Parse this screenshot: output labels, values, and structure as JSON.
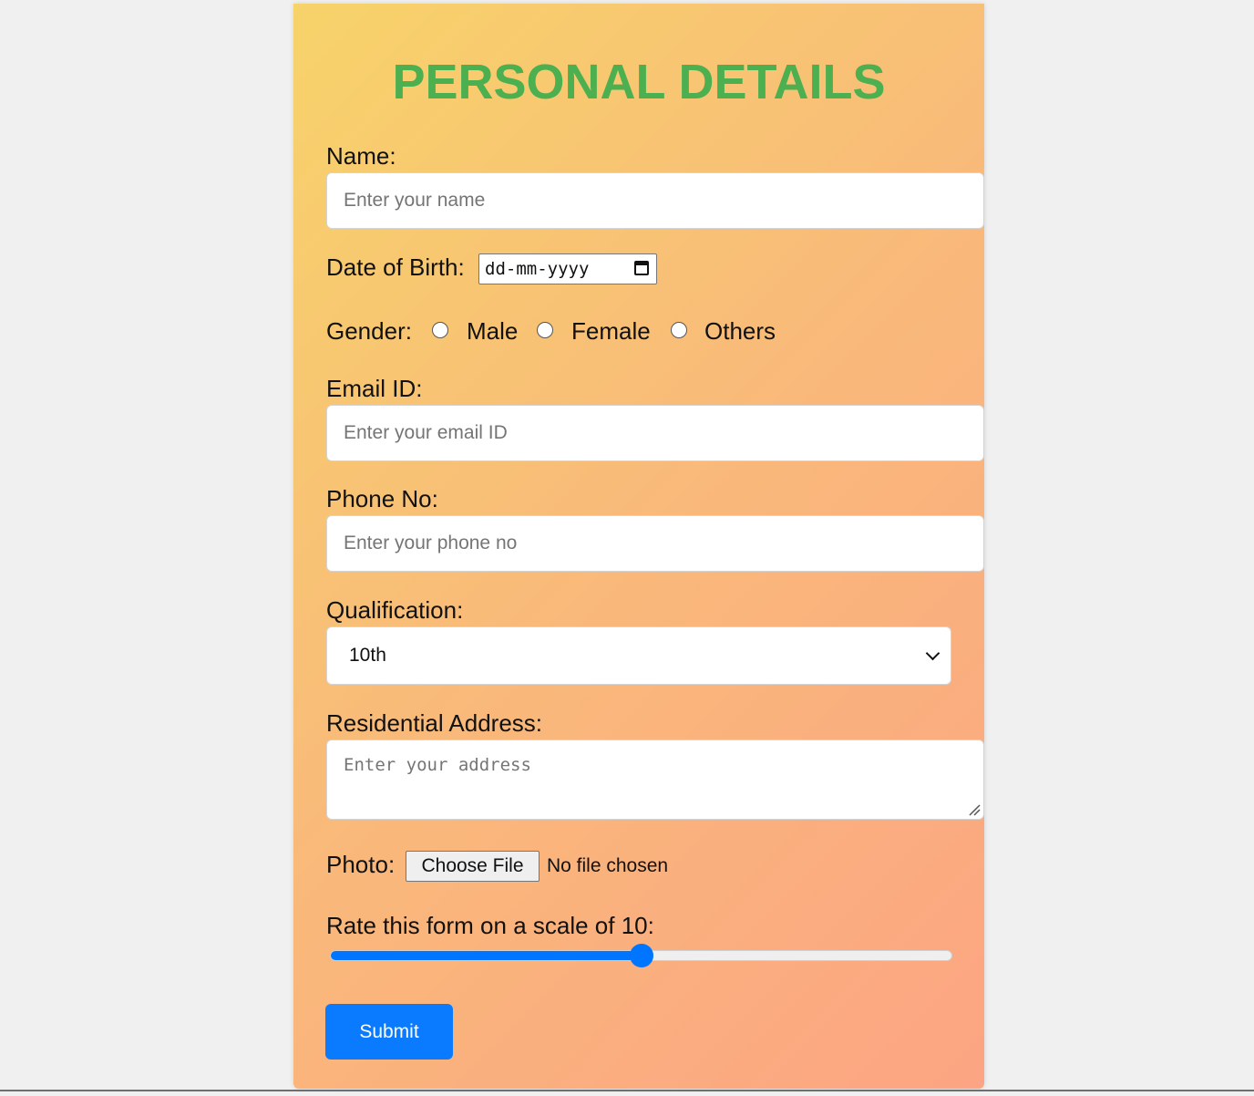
{
  "form": {
    "title": "PERSONAL DETAILS",
    "name": {
      "label": "Name:",
      "placeholder": "Enter your name"
    },
    "dob": {
      "label": "Date of Birth:",
      "value": "dd-mm-yyyy",
      "icon": "calendar-icon"
    },
    "gender": {
      "label": "Gender:",
      "options": [
        "Male",
        "Female",
        "Others"
      ]
    },
    "email": {
      "label": "Email ID:",
      "placeholder": "Enter your email ID"
    },
    "phone": {
      "label": "Phone No:",
      "placeholder": "Enter your phone no"
    },
    "qualification": {
      "label": "Qualification:",
      "selected": "10th",
      "icon": "chevron-down-icon"
    },
    "address": {
      "label": "Residential Address:",
      "placeholder": "Enter your address"
    },
    "photo": {
      "label": "Photo:",
      "button": "Choose File",
      "status": "No file chosen"
    },
    "rating": {
      "label": "Rate this form on a scale of 10:",
      "value": 5,
      "min": 0,
      "max": 10
    },
    "submit_label": "Submit"
  },
  "colors": {
    "title": "#4caf50",
    "accent": "#0075ff",
    "gradient_start": "#f7d36a",
    "gradient_end": "#fca483",
    "background": "#f0f0f0"
  }
}
